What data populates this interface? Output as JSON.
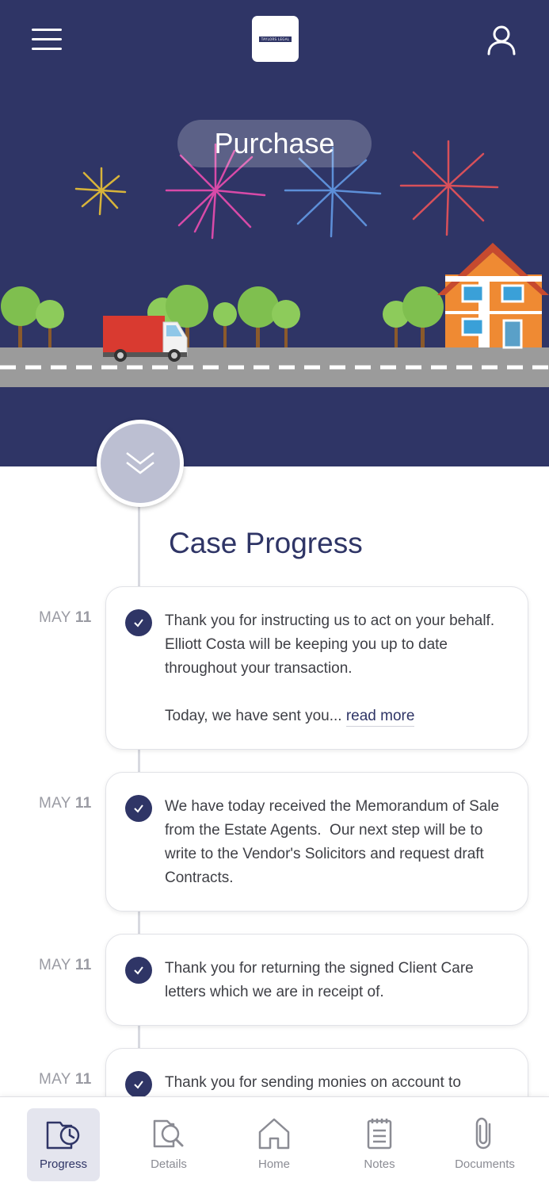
{
  "header": {
    "logo_text": "TAYLORS LEGAL",
    "stage_label": "Purchase"
  },
  "progress": {
    "title": "Case Progress",
    "entries": [
      {
        "month": "MAY",
        "day": "11",
        "text": "Thank you for instructing us to act on your behalf.  Elliott Costa will be keeping you up to date throughout your transaction.\n\nToday, we have sent you... ",
        "link": "read more"
      },
      {
        "month": "MAY",
        "day": "11",
        "text": "We have today received the Memorandum of Sale from the Estate Agents.  Our next step will be to write to the Vendor's Solicitors and request draft Contracts."
      },
      {
        "month": "MAY",
        "day": "11",
        "text": "Thank you for returning the signed Client Care letters which we are in receipt of."
      },
      {
        "month": "MAY",
        "day": "11",
        "text": "Thank you for sending monies on account to"
      }
    ]
  },
  "nav": {
    "items": [
      {
        "label": "Progress",
        "icon": "progress-clock-icon",
        "active": true
      },
      {
        "label": "Details",
        "icon": "details-search-icon"
      },
      {
        "label": "Home",
        "icon": "home-icon"
      },
      {
        "label": "Notes",
        "icon": "notes-icon"
      },
      {
        "label": "Documents",
        "icon": "paperclip-icon"
      }
    ]
  },
  "colors": {
    "brand": "#2f3566",
    "accent_light": "#bcbfd2",
    "active_tab_bg": "#e4e5ee"
  }
}
